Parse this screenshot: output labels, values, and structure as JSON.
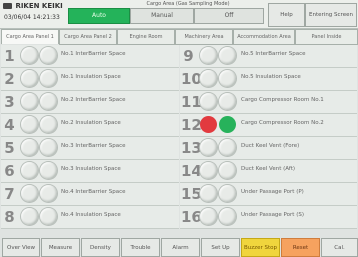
{
  "header": {
    "brand": "RIKEN KEIKI",
    "datetime": "03/06/04  14:21:33",
    "title": "Cargo Area (Gas Sampling Mode)",
    "modes": [
      "Auto",
      "Manual",
      "Off"
    ],
    "help": "Help",
    "entering": "Entering Screen"
  },
  "tabs": [
    "Cargo Area Panel 1",
    "Cargo Area Panel 2",
    "Engine Room",
    "Machinery Area",
    "Accommodation Area",
    "Panel Inside"
  ],
  "sensors": [
    {
      "num": "1",
      "label": "No.1 InterBarrier Space",
      "status": "off"
    },
    {
      "num": "2",
      "label": "No.1 Insulation Space",
      "status": "off"
    },
    {
      "num": "3",
      "label": "No.2 InterBarrier Space",
      "status": "off"
    },
    {
      "num": "4",
      "label": "No.2 Insulation Space",
      "status": "off"
    },
    {
      "num": "5",
      "label": "No.3 InterBarrier Space",
      "status": "off"
    },
    {
      "num": "6",
      "label": "No.3 Insulation Space",
      "status": "off"
    },
    {
      "num": "7",
      "label": "No.4 InterBarrier Space",
      "status": "off"
    },
    {
      "num": "8",
      "label": "No.4 Insulation Space",
      "status": "off"
    },
    {
      "num": "9",
      "label": "No.5 InterBarrier Space",
      "status": "off"
    },
    {
      "num": "10",
      "label": "No.5 Insulation Space",
      "status": "off"
    },
    {
      "num": "11",
      "label": "Cargo Compressor Room No.1",
      "status": "off"
    },
    {
      "num": "12",
      "label": "Cargo Compressor Room No.2",
      "status": "active"
    },
    {
      "num": "13",
      "label": "Duct Keel Vent (Fore)",
      "status": "off"
    },
    {
      "num": "14",
      "label": "Duct Keel Vent (Aft)",
      "status": "off"
    },
    {
      "num": "15",
      "label": "Under Passage Port (P)",
      "status": "off"
    },
    {
      "num": "16",
      "label": "Under Passage Port (S)",
      "status": "off"
    }
  ],
  "footer": [
    "Over View",
    "Measure",
    "Density",
    "Trouble",
    "Alarm",
    "Set Up",
    "Buzzer Stop",
    "Reset",
    "Cal."
  ],
  "colors": {
    "auto_active": "#24b35a",
    "alarm_red": "#e23a3f",
    "ok_green": "#27b25b",
    "buzzer": "#f0d53d",
    "reset": "#f6a25f"
  }
}
